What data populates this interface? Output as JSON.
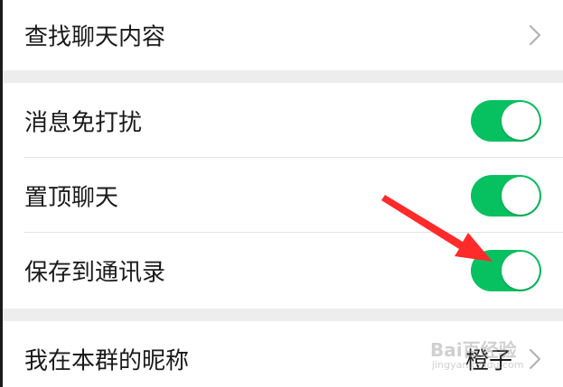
{
  "settings": {
    "search_chat_label": "查找聊天内容",
    "mute_label": "消息免打扰",
    "mute_on": true,
    "pin_label": "置顶聊天",
    "pin_on": true,
    "save_contacts_label": "保存到通讯录",
    "save_contacts_on": true,
    "nickname_label": "我在本群的昵称",
    "nickname_value": "橙子"
  },
  "watermark": {
    "brand": "Bai百经验",
    "url": "jingyan.baidu.com"
  },
  "colors": {
    "toggle_on": "#07c160",
    "annotation_arrow": "#ff2a2a",
    "background": "#ededed"
  }
}
